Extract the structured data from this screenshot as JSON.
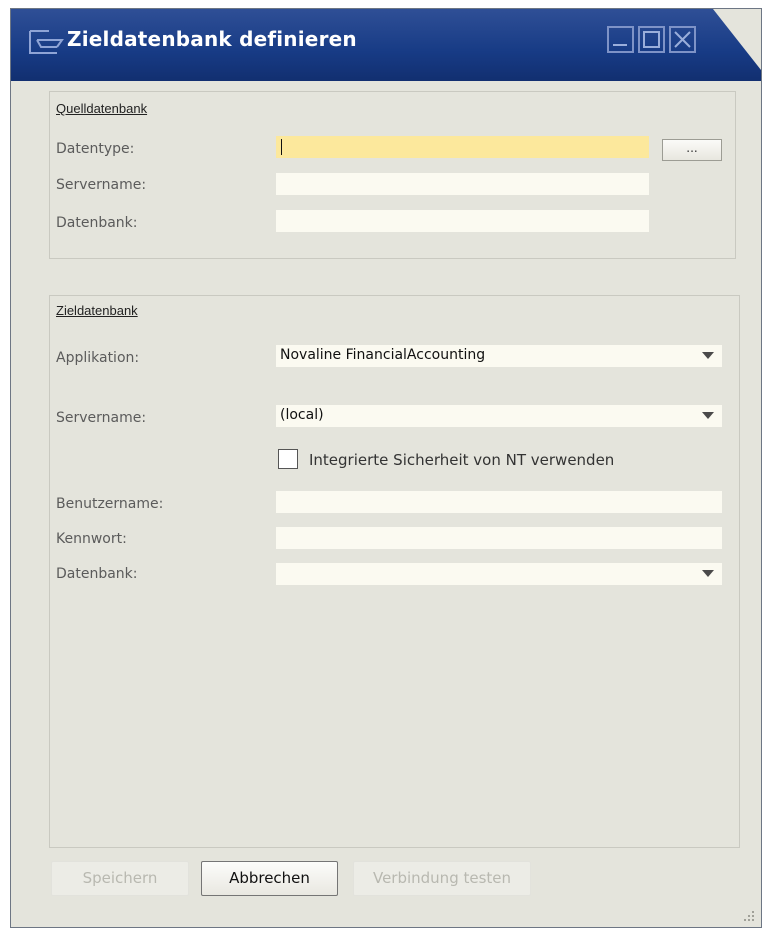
{
  "window": {
    "title": "Zieldatenbank definieren"
  },
  "source_group": {
    "title": "Quelldatenbank",
    "datatype_label": "Datentype:",
    "datatype_value": "",
    "browse_label": "...",
    "server_label": "Servername:",
    "server_value": "",
    "database_label": "Datenbank:",
    "database_value": ""
  },
  "target_group": {
    "title": "Zieldatenbank",
    "application_label": "Applikation:",
    "application_value": "Novaline FinancialAccounting",
    "server_label": "Servername:",
    "server_value": "(local)",
    "nt_security_label": "Integrierte Sicherheit von NT verwenden",
    "nt_security_checked": false,
    "username_label": "Benutzername:",
    "username_value": "",
    "password_label": "Kennwort:",
    "password_value": "",
    "database_label": "Datenbank:",
    "database_value": ""
  },
  "buttons": {
    "save": "Speichern",
    "cancel": "Abbrechen",
    "test": "Verbindung testen"
  },
  "colors": {
    "titlebar": "#1b3d88",
    "dialog_bg": "#e4e4dc",
    "active_field": "#fce89c",
    "field": "#fbfaf1"
  }
}
